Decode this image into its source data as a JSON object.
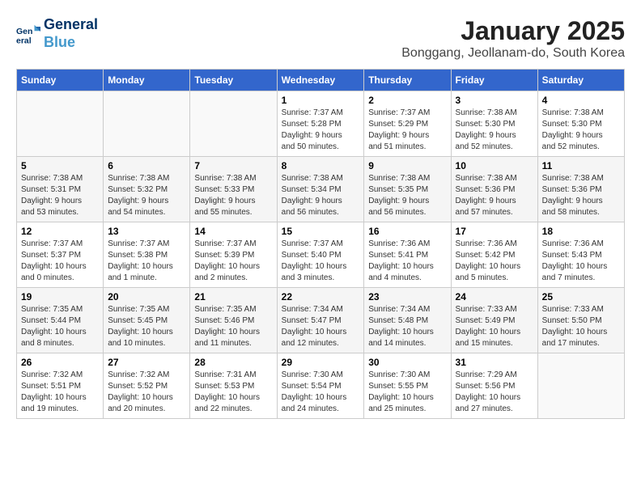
{
  "header": {
    "logo_line1": "General",
    "logo_line2": "Blue",
    "month": "January 2025",
    "location": "Bonggang, Jeollanam-do, South Korea"
  },
  "weekdays": [
    "Sunday",
    "Monday",
    "Tuesday",
    "Wednesday",
    "Thursday",
    "Friday",
    "Saturday"
  ],
  "weeks": [
    [
      {
        "day": "",
        "info": ""
      },
      {
        "day": "",
        "info": ""
      },
      {
        "day": "",
        "info": ""
      },
      {
        "day": "1",
        "info": "Sunrise: 7:37 AM\nSunset: 5:28 PM\nDaylight: 9 hours\nand 50 minutes."
      },
      {
        "day": "2",
        "info": "Sunrise: 7:37 AM\nSunset: 5:29 PM\nDaylight: 9 hours\nand 51 minutes."
      },
      {
        "day": "3",
        "info": "Sunrise: 7:38 AM\nSunset: 5:30 PM\nDaylight: 9 hours\nand 52 minutes."
      },
      {
        "day": "4",
        "info": "Sunrise: 7:38 AM\nSunset: 5:30 PM\nDaylight: 9 hours\nand 52 minutes."
      }
    ],
    [
      {
        "day": "5",
        "info": "Sunrise: 7:38 AM\nSunset: 5:31 PM\nDaylight: 9 hours\nand 53 minutes."
      },
      {
        "day": "6",
        "info": "Sunrise: 7:38 AM\nSunset: 5:32 PM\nDaylight: 9 hours\nand 54 minutes."
      },
      {
        "day": "7",
        "info": "Sunrise: 7:38 AM\nSunset: 5:33 PM\nDaylight: 9 hours\nand 55 minutes."
      },
      {
        "day": "8",
        "info": "Sunrise: 7:38 AM\nSunset: 5:34 PM\nDaylight: 9 hours\nand 56 minutes."
      },
      {
        "day": "9",
        "info": "Sunrise: 7:38 AM\nSunset: 5:35 PM\nDaylight: 9 hours\nand 56 minutes."
      },
      {
        "day": "10",
        "info": "Sunrise: 7:38 AM\nSunset: 5:36 PM\nDaylight: 9 hours\nand 57 minutes."
      },
      {
        "day": "11",
        "info": "Sunrise: 7:38 AM\nSunset: 5:36 PM\nDaylight: 9 hours\nand 58 minutes."
      }
    ],
    [
      {
        "day": "12",
        "info": "Sunrise: 7:37 AM\nSunset: 5:37 PM\nDaylight: 10 hours\nand 0 minutes."
      },
      {
        "day": "13",
        "info": "Sunrise: 7:37 AM\nSunset: 5:38 PM\nDaylight: 10 hours\nand 1 minute."
      },
      {
        "day": "14",
        "info": "Sunrise: 7:37 AM\nSunset: 5:39 PM\nDaylight: 10 hours\nand 2 minutes."
      },
      {
        "day": "15",
        "info": "Sunrise: 7:37 AM\nSunset: 5:40 PM\nDaylight: 10 hours\nand 3 minutes."
      },
      {
        "day": "16",
        "info": "Sunrise: 7:36 AM\nSunset: 5:41 PM\nDaylight: 10 hours\nand 4 minutes."
      },
      {
        "day": "17",
        "info": "Sunrise: 7:36 AM\nSunset: 5:42 PM\nDaylight: 10 hours\nand 5 minutes."
      },
      {
        "day": "18",
        "info": "Sunrise: 7:36 AM\nSunset: 5:43 PM\nDaylight: 10 hours\nand 7 minutes."
      }
    ],
    [
      {
        "day": "19",
        "info": "Sunrise: 7:35 AM\nSunset: 5:44 PM\nDaylight: 10 hours\nand 8 minutes."
      },
      {
        "day": "20",
        "info": "Sunrise: 7:35 AM\nSunset: 5:45 PM\nDaylight: 10 hours\nand 10 minutes."
      },
      {
        "day": "21",
        "info": "Sunrise: 7:35 AM\nSunset: 5:46 PM\nDaylight: 10 hours\nand 11 minutes."
      },
      {
        "day": "22",
        "info": "Sunrise: 7:34 AM\nSunset: 5:47 PM\nDaylight: 10 hours\nand 12 minutes."
      },
      {
        "day": "23",
        "info": "Sunrise: 7:34 AM\nSunset: 5:48 PM\nDaylight: 10 hours\nand 14 minutes."
      },
      {
        "day": "24",
        "info": "Sunrise: 7:33 AM\nSunset: 5:49 PM\nDaylight: 10 hours\nand 15 minutes."
      },
      {
        "day": "25",
        "info": "Sunrise: 7:33 AM\nSunset: 5:50 PM\nDaylight: 10 hours\nand 17 minutes."
      }
    ],
    [
      {
        "day": "26",
        "info": "Sunrise: 7:32 AM\nSunset: 5:51 PM\nDaylight: 10 hours\nand 19 minutes."
      },
      {
        "day": "27",
        "info": "Sunrise: 7:32 AM\nSunset: 5:52 PM\nDaylight: 10 hours\nand 20 minutes."
      },
      {
        "day": "28",
        "info": "Sunrise: 7:31 AM\nSunset: 5:53 PM\nDaylight: 10 hours\nand 22 minutes."
      },
      {
        "day": "29",
        "info": "Sunrise: 7:30 AM\nSunset: 5:54 PM\nDaylight: 10 hours\nand 24 minutes."
      },
      {
        "day": "30",
        "info": "Sunrise: 7:30 AM\nSunset: 5:55 PM\nDaylight: 10 hours\nand 25 minutes."
      },
      {
        "day": "31",
        "info": "Sunrise: 7:29 AM\nSunset: 5:56 PM\nDaylight: 10 hours\nand 27 minutes."
      },
      {
        "day": "",
        "info": ""
      }
    ]
  ]
}
